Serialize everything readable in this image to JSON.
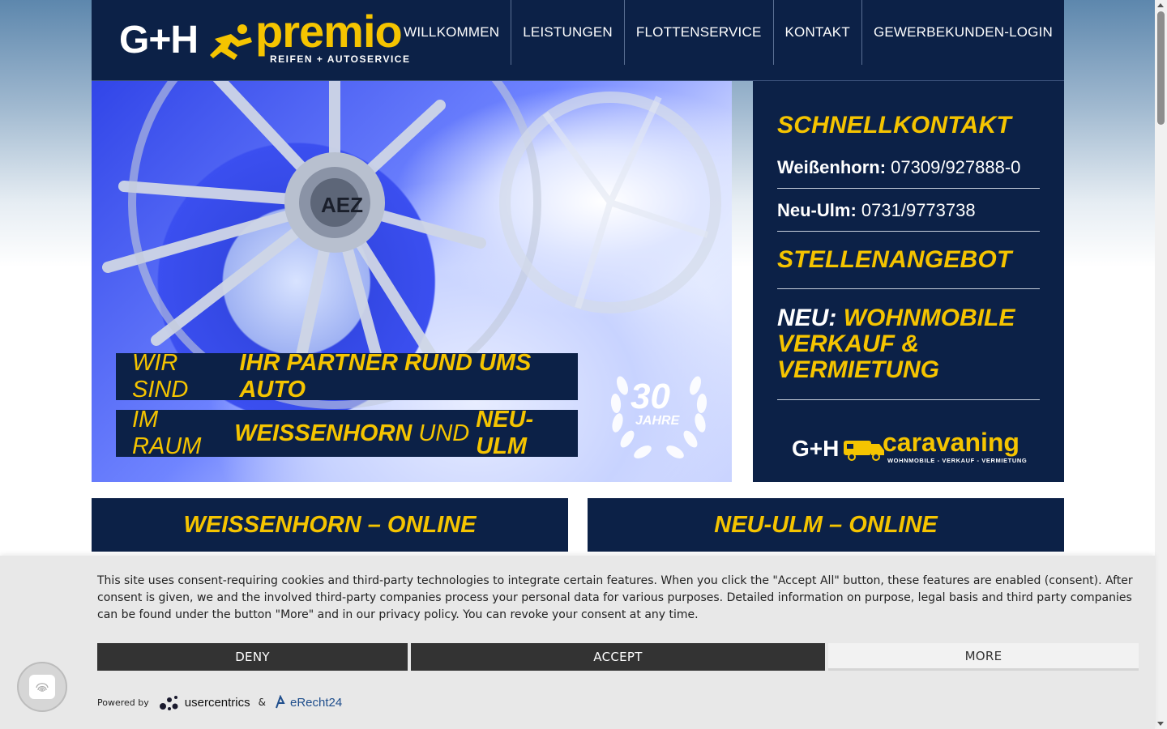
{
  "header": {
    "logo": {
      "brand_left": "G+H",
      "brand_right": "premio",
      "tagline": "REIFEN + AUTOSERVICE"
    },
    "nav": [
      "WILLKOMMEN",
      "LEISTUNGEN",
      "FLOTTENSERVICE",
      "KONTAKT",
      "GEWERBEKUNDEN-LOGIN"
    ]
  },
  "hero": {
    "line1_light": "WIR SIND",
    "line1_bold": "IHR PARTNER RUND UMS AUTO",
    "line2_light_a": "IM RAUM",
    "line2_bold_a": "WEISSENHORN",
    "line2_light_b": "UND",
    "line2_bold_b": "NEU-ULM",
    "wheel_brand": "AEZ",
    "badge_number": "30",
    "badge_word": "JAHRE"
  },
  "panel": {
    "contact_title": "SCHNELLKONTAKT",
    "contacts": [
      {
        "label": "Weißenhorn:",
        "phone": "07309/927888-0"
      },
      {
        "label": "Neu-Ulm:",
        "phone": "0731/9773738"
      }
    ],
    "jobs_title": "STELLENANGEBOT",
    "new_prefix": "NEU:",
    "new_text": "WOHNMOBILE VERKAUF & VERMIETUNG",
    "caravan_logo": {
      "left": "G+H",
      "word": "caravaning",
      "sub": "WOHNMOBILE - VERKAUF - VERMIETUNG"
    }
  },
  "online": [
    "WEISSENHORN – ONLINE",
    "NEU-ULM – ONLINE"
  ],
  "cookie": {
    "text": "This site uses consent-requiring cookies and third-party technologies to integrate certain features. When you click the \"Accept All\" button, these features are enabled (consent). After consent is given, we and the involved third-party companies process your personal data for various purposes. Detailed information on purpose, legal basis and third party companies can be found under the button \"More\" and in our privacy policy. You can revoke your consent at any time.",
    "deny": "DENY",
    "accept": "ACCEPT",
    "more": "MORE",
    "powered_by": "Powered by",
    "usercentrics": "usercentrics",
    "amp": "&",
    "erecht": "eRecht24"
  },
  "colors": {
    "navy": "#0c2147",
    "yellow": "#f5c400",
    "cookie_bg": "#e8e8e8",
    "button_dark": "#333333"
  },
  "icons": [
    "runner-logo-icon",
    "caravan-truck-icon",
    "laurel-wreath-icon",
    "fingerprint-icon",
    "usercentrics-dots-icon",
    "erecht-icon"
  ]
}
